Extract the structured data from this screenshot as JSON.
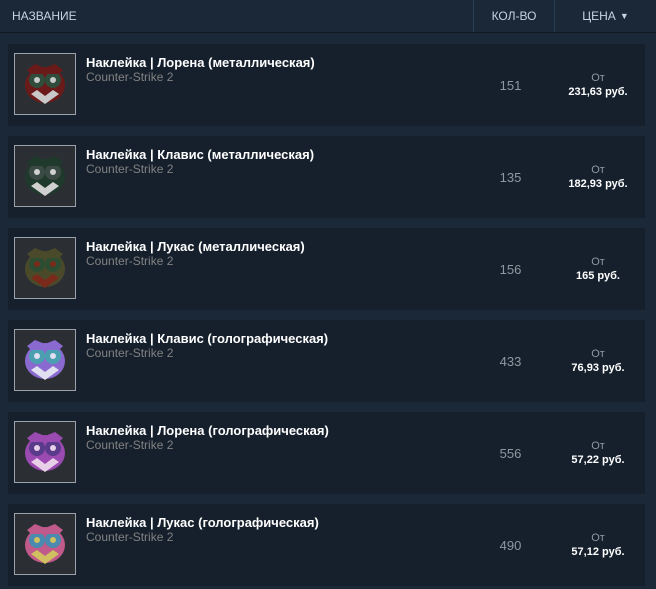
{
  "header": {
    "name_label": "НАЗВАНИЕ",
    "qty_label": "КОЛ-ВО",
    "price_label": "ЦЕНА",
    "sort_icon": "▼"
  },
  "items": [
    {
      "name": "Наклейка | Лорена (металлическая)",
      "game": "Counter-Strike 2",
      "qty": "151",
      "price_from": "От",
      "price": "231,63 руб.",
      "icon": "sticker-lorena-metallic-icon",
      "colors": [
        "#6b1a1a",
        "#2f4d3a",
        "#c9c9c9"
      ]
    },
    {
      "name": "Наклейка | Клавис (металлическая)",
      "game": "Counter-Strike 2",
      "qty": "135",
      "price_from": "От",
      "price": "182,93 руб.",
      "icon": "sticker-klavis-metallic-icon",
      "colors": [
        "#1f3a2c",
        "#3c4a46",
        "#d0d0d0"
      ]
    },
    {
      "name": "Наклейка | Лукас (металлическая)",
      "game": "Counter-Strike 2",
      "qty": "156",
      "price_from": "От",
      "price": "165 руб.",
      "icon": "sticker-lukas-metallic-icon",
      "colors": [
        "#4a4a2a",
        "#2d4d33",
        "#7a2a1a"
      ]
    },
    {
      "name": "Наклейка | Клавис (голографическая)",
      "game": "Counter-Strike 2",
      "qty": "433",
      "price_from": "От",
      "price": "76,93 руб.",
      "icon": "sticker-klavis-holo-icon",
      "colors": [
        "#8a6ad0",
        "#4aa0b0",
        "#e0e0f0"
      ]
    },
    {
      "name": "Наклейка | Лорена (голографическая)",
      "game": "Counter-Strike 2",
      "qty": "556",
      "price_from": "От",
      "price": "57,22 руб.",
      "icon": "sticker-lorena-holo-icon",
      "colors": [
        "#9a4ab0",
        "#5a3a8a",
        "#e8d0e8"
      ]
    },
    {
      "name": "Наклейка | Лукас (голографическая)",
      "game": "Counter-Strike 2",
      "qty": "490",
      "price_from": "От",
      "price": "57,12 руб.",
      "icon": "sticker-lukas-holo-icon",
      "colors": [
        "#c05a8a",
        "#4a8ab0",
        "#d0c060"
      ]
    }
  ]
}
